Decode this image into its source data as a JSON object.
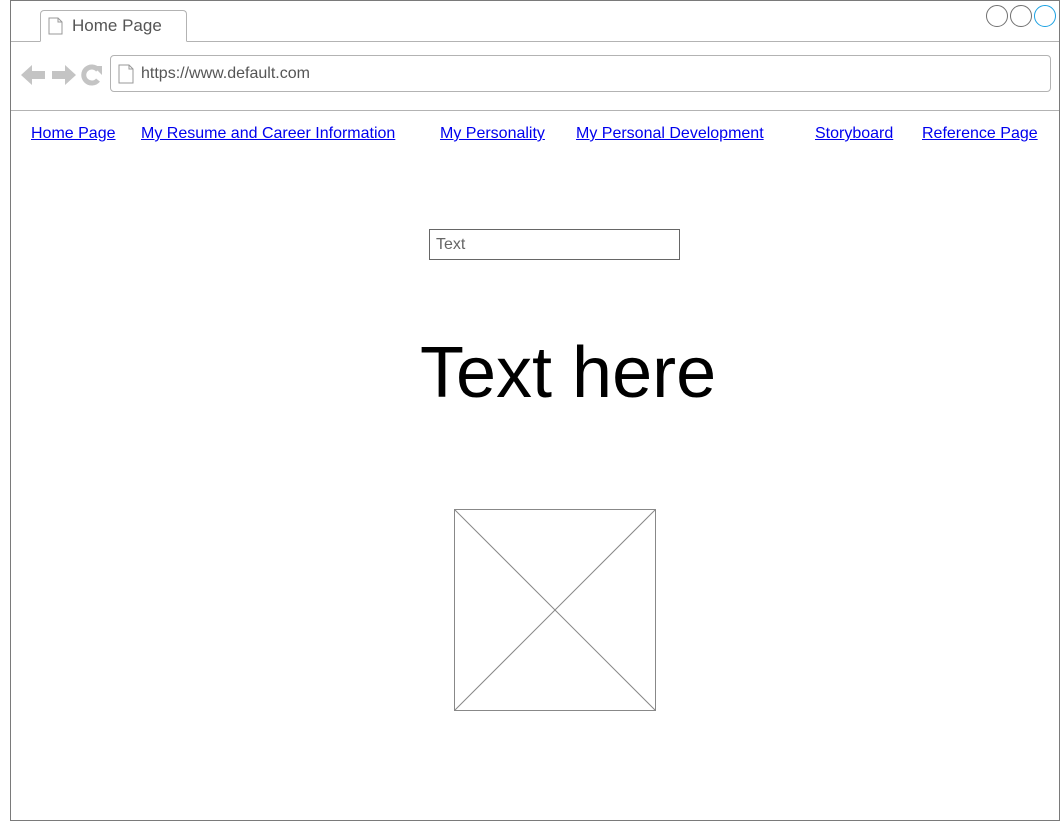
{
  "browser": {
    "tab": {
      "title": "Home Page",
      "icon": "page-icon"
    },
    "window_controls": [
      "minimize-circle",
      "maximize-circle",
      "close-circle"
    ],
    "accent_color": "#1ba1e2",
    "url": "https://www.default.com"
  },
  "nav_links": [
    "Home Page",
    "My Resume and Career Information",
    "My Personality",
    "My Personal Development",
    "Storyboard",
    "Reference Page"
  ],
  "content": {
    "input": {
      "placeholder": "Text"
    },
    "heading": "Text here",
    "image": "image-placeholder"
  }
}
